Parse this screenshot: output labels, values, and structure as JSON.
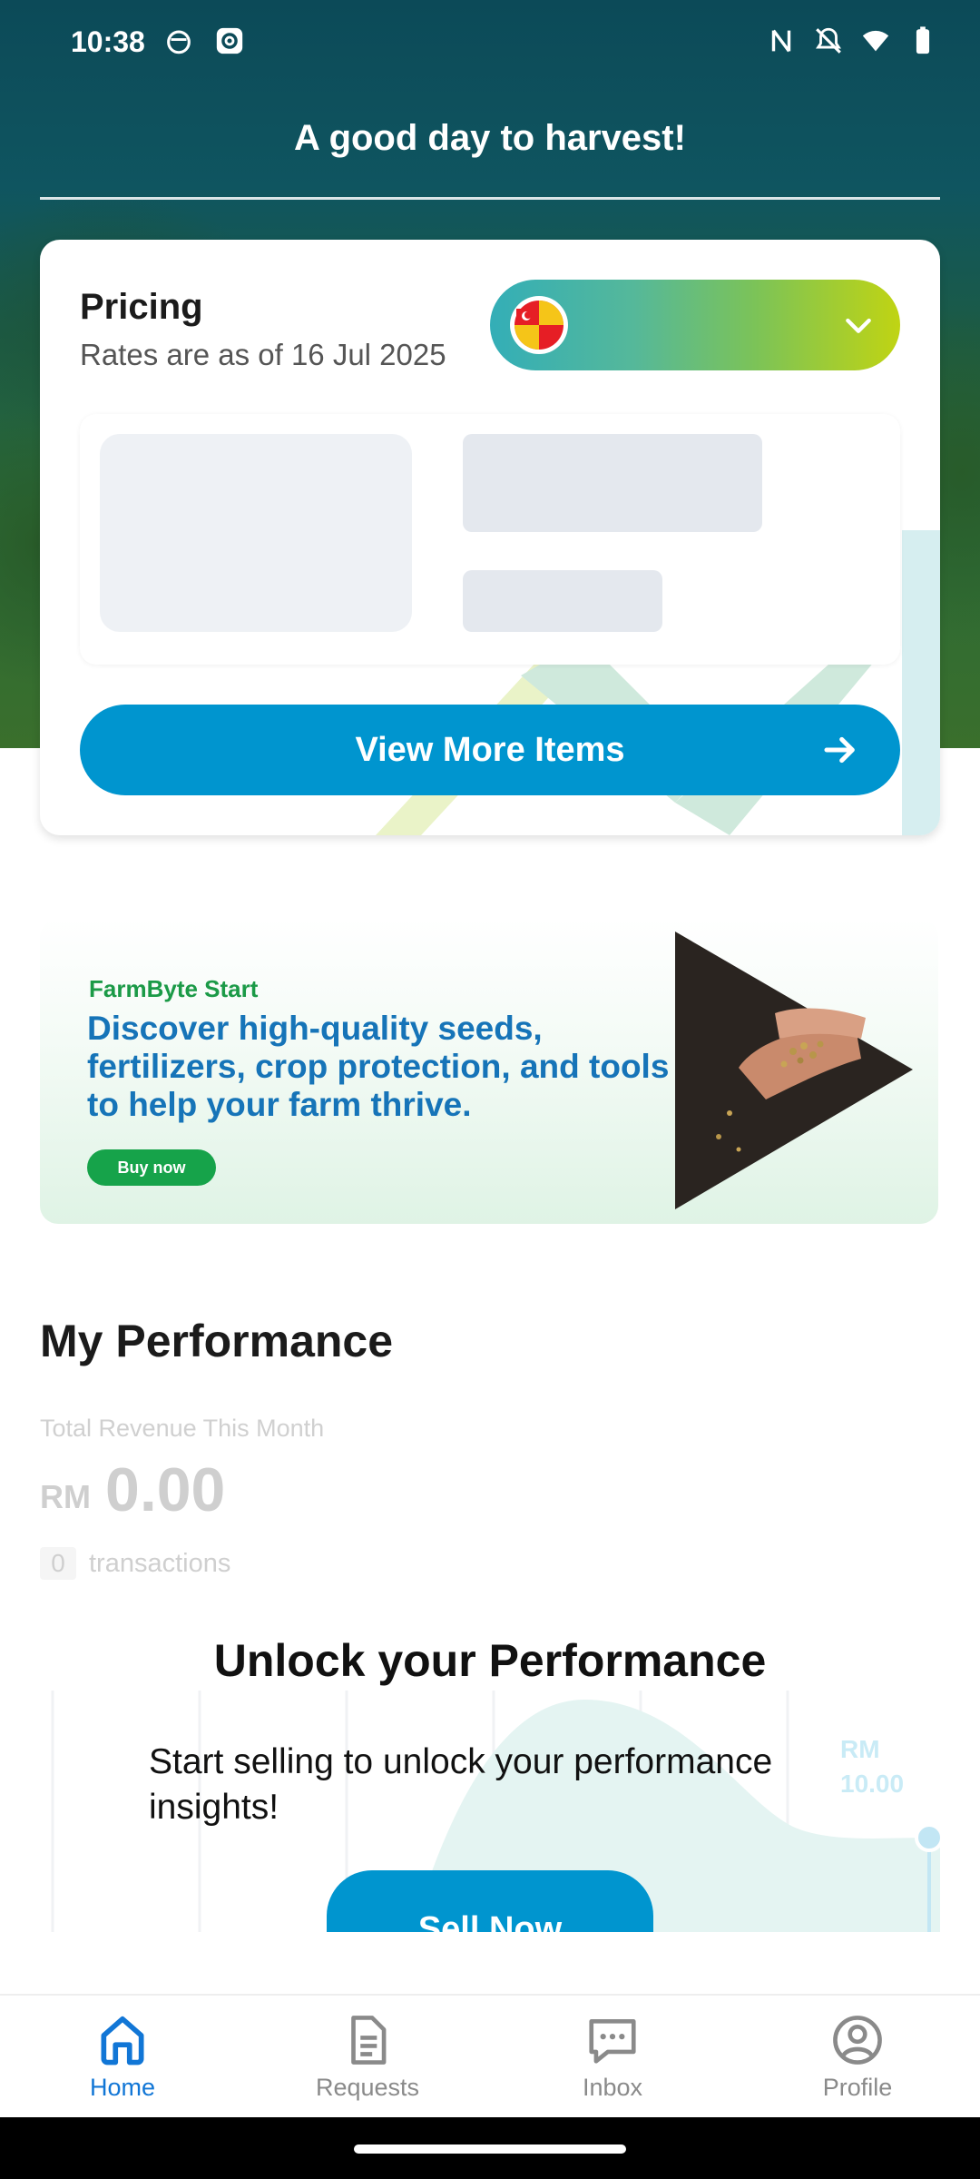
{
  "status_bar": {
    "time": "10:38",
    "left_icons": [
      "notification-icon",
      "settings-notification-icon"
    ],
    "right_icons": [
      "nfc-icon",
      "silent-icon",
      "wifi-icon",
      "battery-icon"
    ]
  },
  "header": {
    "greeting": "A good day to harvest!"
  },
  "pricing": {
    "title": "Pricing",
    "subtitle": "Rates are as of 16 Jul 2025",
    "region_flag_icon": "selangor-flag-icon",
    "view_more_label": "View More Items"
  },
  "banner": {
    "brand": "FarmByte Start",
    "headline": "Discover high-quality seeds, fertilizers, crop protection, and tools to help your farm thrive.",
    "cta": "Buy now"
  },
  "performance": {
    "title": "My Performance",
    "revenue_label": "Total Revenue This Month",
    "currency": "RM",
    "amount": "0.00",
    "transactions_count": "0",
    "transactions_label": "transactions",
    "chart_value_currency": "RM",
    "chart_value": "10.00",
    "unlock_title": "Unlock your Performance",
    "unlock_subtitle": "Start selling to unlock your performance insights!",
    "sell_now_label": "Sell Now"
  },
  "nav": {
    "items": [
      {
        "label": "Home",
        "icon": "home-icon",
        "active": true
      },
      {
        "label": "Requests",
        "icon": "document-icon",
        "active": false
      },
      {
        "label": "Inbox",
        "icon": "chat-icon",
        "active": false
      },
      {
        "label": "Profile",
        "icon": "profile-icon",
        "active": false
      }
    ]
  },
  "colors": {
    "primary_blue": "#0095cf",
    "brand_green": "#16a34a",
    "active_nav": "#1176d6"
  }
}
